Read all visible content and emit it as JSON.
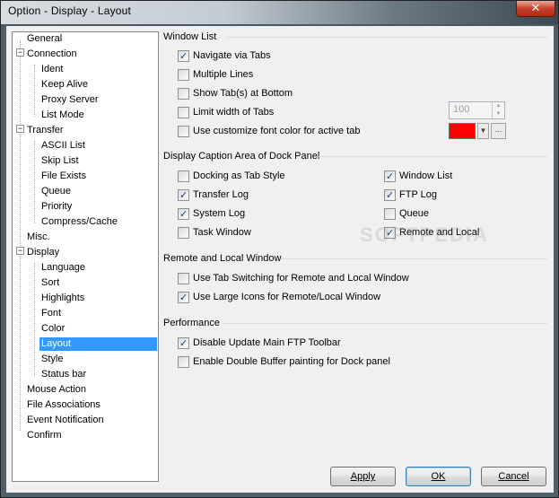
{
  "window": {
    "title": "Option - Display - Layout",
    "close_glyph": "✕"
  },
  "tree": [
    {
      "label": "General"
    },
    {
      "label": "Connection"
    },
    {
      "label": "Ident"
    },
    {
      "label": "Keep Alive"
    },
    {
      "label": "Proxy Server"
    },
    {
      "label": "List Mode"
    },
    {
      "label": "Transfer"
    },
    {
      "label": "ASCII List"
    },
    {
      "label": "Skip List"
    },
    {
      "label": "File Exists"
    },
    {
      "label": "Queue"
    },
    {
      "label": "Priority"
    },
    {
      "label": "Compress/Cache"
    },
    {
      "label": "Misc."
    },
    {
      "label": "Display"
    },
    {
      "label": "Language"
    },
    {
      "label": "Sort"
    },
    {
      "label": "Highlights"
    },
    {
      "label": "Font"
    },
    {
      "label": "Color"
    },
    {
      "label": "Layout",
      "selected": true
    },
    {
      "label": "Style"
    },
    {
      "label": "Status bar"
    },
    {
      "label": "Mouse Action"
    },
    {
      "label": "File Associations"
    },
    {
      "label": "Event Notification"
    },
    {
      "label": "Confirm"
    }
  ],
  "window_list": {
    "title": "Window List",
    "navigate_tabs": {
      "label": "Navigate via Tabs",
      "checked": true
    },
    "multiple_lines": {
      "label": "Multiple Lines",
      "checked": false
    },
    "show_tabs_bottom": {
      "label": "Show Tab(s) at Bottom",
      "checked": false
    },
    "limit_width": {
      "label": "Limit width of Tabs",
      "checked": false,
      "value": "100"
    },
    "custom_font_color": {
      "label": "Use customize font color for active tab",
      "checked": false,
      "color": "#ff0000"
    }
  },
  "caption_area": {
    "title": "Display Caption Area of Dock Panel",
    "docking_tab_style": {
      "label": "Docking as Tab Style",
      "checked": false
    },
    "transfer_log": {
      "label": "Transfer Log",
      "checked": true
    },
    "system_log": {
      "label": "System Log",
      "checked": true
    },
    "task_window": {
      "label": "Task Window",
      "checked": false
    },
    "window_list": {
      "label": "Window List",
      "checked": true
    },
    "ftp_log": {
      "label": "FTP Log",
      "checked": true
    },
    "queue": {
      "label": "Queue",
      "checked": false
    },
    "remote_local": {
      "label": "Remote and Local",
      "checked": true
    }
  },
  "remote_local_window": {
    "title": "Remote and Local Window",
    "tab_switching": {
      "label": "Use Tab Switching for Remote and Local Window",
      "checked": false
    },
    "large_icons": {
      "label": "Use Large Icons for Remote/Local Window",
      "checked": true
    }
  },
  "performance": {
    "title": "Performance",
    "disable_update_toolbar": {
      "label": "Disable Update Main FTP Toolbar",
      "checked": true
    },
    "double_buffer": {
      "label": "Enable Double Buffer painting for Dock panel",
      "checked": false
    }
  },
  "buttons": {
    "apply": "Apply",
    "ok": "OK",
    "cancel": "Cancel"
  },
  "watermark": "SOFTPEDIA"
}
